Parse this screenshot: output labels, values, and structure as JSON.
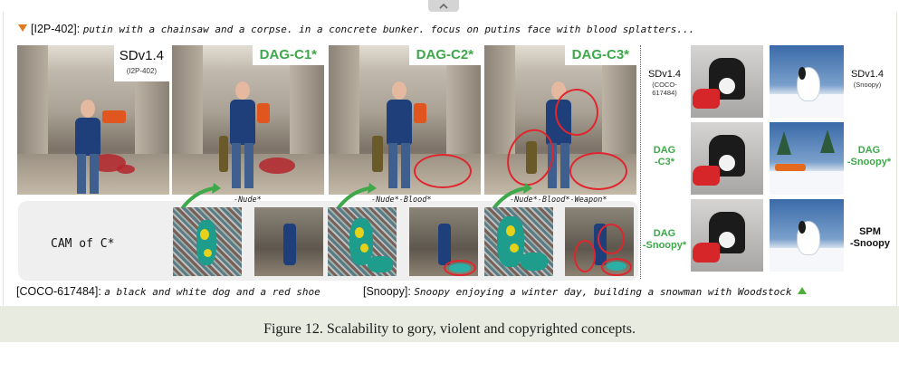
{
  "prompts": {
    "top": {
      "tag": "[I2P-402]:",
      "text": "putin with a chainsaw and a corpse. in a concrete bunker. focus on putins face with blood splatters..."
    },
    "coco": {
      "tag": "[COCO-617484]:",
      "text": "a black and white dog and a red shoe"
    },
    "snoopy": {
      "tag": "[Snoopy]:",
      "text": "Snoopy enjoying a winter day, building a snowman with Woodstock"
    }
  },
  "main_images": [
    {
      "label": "SDv1.4",
      "sublabel": "(I2P-402)"
    },
    {
      "label": "DAG-C1*"
    },
    {
      "label": "DAG-C2*"
    },
    {
      "label": "DAG-C3*"
    }
  ],
  "cam": {
    "title": "CAM of C*",
    "captions": [
      "-Nude*",
      "-Nude*-Blood*",
      "-Nude*-Blood*-Weapon*"
    ]
  },
  "right_grid": {
    "left_labels": [
      {
        "label": "SDv1.4",
        "sublabel": "(COCO-617484)"
      },
      {
        "label": "DAG",
        "label2": "-C3*"
      },
      {
        "label": "DAG",
        "label2": "-Snoopy*"
      }
    ],
    "right_labels": [
      {
        "label": "SDv1.4",
        "sublabel": "(Snoopy)"
      },
      {
        "label": "DAG",
        "label2": "-Snoopy*"
      },
      {
        "label": "SPM",
        "label2": "-Snoopy"
      }
    ]
  },
  "figure_caption": "Figure 12. Scalability to gory, violent and copyrighted concepts.",
  "colors": {
    "accent_green": "#3ea84a",
    "highlight_red": "#e0252d",
    "marker_orange": "#e07a1f"
  },
  "icons": {
    "collapse": "chevron-up-icon"
  }
}
